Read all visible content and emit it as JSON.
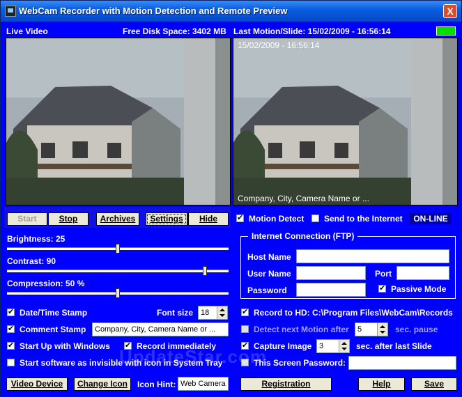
{
  "window": {
    "title": "WebCam Recorder with Motion Detection and Remote Preview",
    "close_label": "X"
  },
  "header": {
    "live_video": "Live Video",
    "free_disk": "Free Disk Space: 3402 MB",
    "last_motion": "Last Motion/Slide:  15/02/2009 - 16:56:14"
  },
  "preview": {
    "timestamp": "15/02/2009 - 16:56:14",
    "caption": "Company, City, Camera Name or ..."
  },
  "toolbar": {
    "start": "Start",
    "stop": "Stop",
    "archives": "Archives",
    "settings": "Settings",
    "hide": "Hide",
    "motion_detect": "Motion Detect",
    "send_internet": "Send to the Internet",
    "status": "ON-LINE",
    "motion_detect_checked": true,
    "send_internet_checked": false
  },
  "sliders": {
    "brightness": {
      "label": "Brightness:  25",
      "value": 25,
      "max": 50
    },
    "contrast": {
      "label": "Contrast:  90",
      "value": 90,
      "max": 100
    },
    "compression": {
      "label": "Compression:  50 %",
      "value": 50,
      "max": 100
    }
  },
  "options": {
    "datetime_stamp": "Date/Time Stamp",
    "font_size_label": "Font size",
    "font_size": "18",
    "comment_stamp": "Comment Stamp",
    "comment_text": "Company, City, Camera Name or ...",
    "startup_windows": "Start Up with Windows",
    "record_immediately": "Record immediately",
    "invisible_tray": "Start software as invisible with icon in System Tray"
  },
  "bottom": {
    "video_device": "Video Device",
    "change_icon": "Change Icon",
    "icon_hint_label": "Icon Hint:",
    "icon_hint": "Web Camera",
    "registration": "Registration",
    "help": "Help",
    "save": "Save"
  },
  "ftp": {
    "title": "Internet Connection (FTP)",
    "host_name": "Host Name",
    "user_name": "User Name",
    "port": "Port",
    "password": "Password",
    "passive_mode": "Passive Mode",
    "host_value": "",
    "user_value": "",
    "port_value": "",
    "password_value": ""
  },
  "record": {
    "record_hd": "Record to HD:  C:\\Program Files\\WebCam\\Records",
    "detect_next": "Detect next Motion after",
    "detect_value": "5",
    "sec_pause": "sec. pause",
    "capture_image": "Capture Image",
    "capture_value": "3",
    "sec_after": "sec. after last Slide",
    "screen_password": "This Screen Password:",
    "screen_password_value": ""
  },
  "watermark": "UpdateStar.com",
  "icons": [
    "app-icon",
    "close-icon",
    "spin-icon"
  ]
}
